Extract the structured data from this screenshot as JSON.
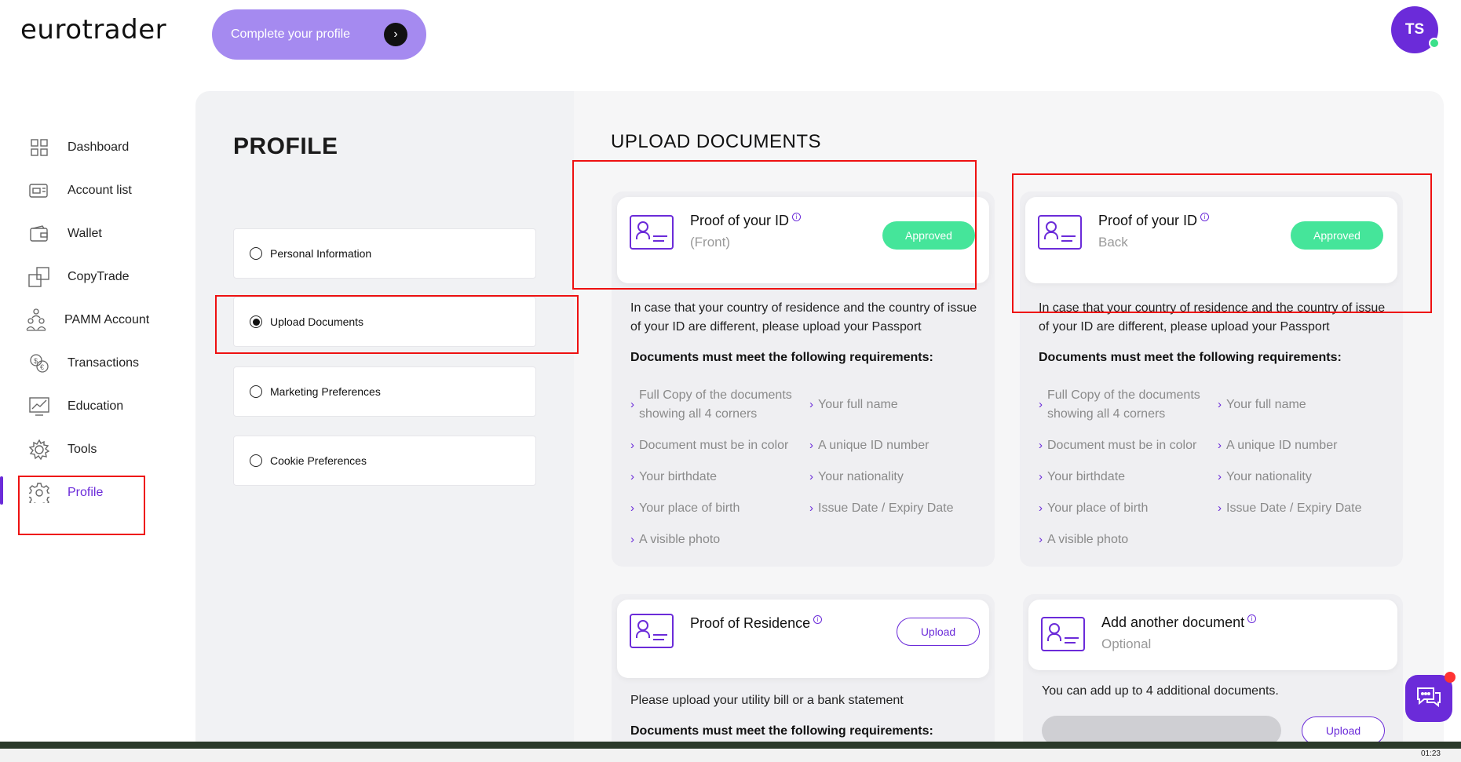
{
  "header": {
    "logo": "eurotrader",
    "cta_label": "Complete your profile",
    "avatar_initials": "TS"
  },
  "sidebar": {
    "items": [
      {
        "label": "Dashboard",
        "icon": "grid-icon"
      },
      {
        "label": "Account list",
        "icon": "account-list-icon"
      },
      {
        "label": "Wallet",
        "icon": "wallet-icon"
      },
      {
        "label": "CopyTrade",
        "icon": "copytrade-icon"
      },
      {
        "label": "PAMM Account",
        "icon": "pamm-icon"
      },
      {
        "label": "Transactions",
        "icon": "transactions-icon"
      },
      {
        "label": "Education",
        "icon": "education-icon"
      },
      {
        "label": "Tools",
        "icon": "tools-icon"
      },
      {
        "label": "Profile",
        "icon": "gear-icon"
      }
    ],
    "active": "Profile"
  },
  "profile": {
    "title": "PROFILE",
    "options": [
      {
        "label": "Personal Information",
        "selected": false
      },
      {
        "label": "Upload Documents",
        "selected": true
      },
      {
        "label": "Marketing Preferences",
        "selected": false
      },
      {
        "label": "Cookie Preferences",
        "selected": false
      }
    ]
  },
  "upload": {
    "title": "UPLOAD DOCUMENTS",
    "id_front": {
      "title": "Proof of your ID",
      "subtitle": "(Front)",
      "status": "Approved",
      "note_line1": "In case that your country of residence and the country of issue",
      "note_line2": "of your ID are different, please upload your Passport",
      "req_heading": "Documents must meet the following requirements:",
      "req_left": [
        "Full Copy of the documents showing all 4 corners",
        "Document must be in color",
        "Your birthdate",
        "Your place of birth",
        "A visible photo"
      ],
      "req_right": [
        "Your full name",
        "A unique ID number",
        "Your nationality",
        "Issue Date / Expiry Date"
      ]
    },
    "id_back": {
      "title": "Proof of your ID",
      "subtitle": "Back",
      "status": "Approved",
      "note_line1": "In case that your country of residence and the country of issue",
      "note_line2": "of your ID are different, please upload your Passport",
      "req_heading": "Documents must meet the following requirements:",
      "req_left": [
        "Full Copy of the documents showing all 4 corners",
        "Document must be in color",
        "Your birthdate",
        "Your place of birth",
        "A visible photo"
      ],
      "req_right": [
        "Your full name",
        "A unique ID number",
        "Your nationality",
        "Issue Date / Expiry Date"
      ]
    },
    "residence": {
      "title": "Proof of Residence",
      "button": "Upload",
      "note": "Please upload your utility bill or a bank statement",
      "req_heading": "Documents must meet the following requirements:"
    },
    "another": {
      "title": "Add another document",
      "subtitle": "Optional",
      "note": "You can add up to 4 additional documents.",
      "button": "Upload"
    }
  },
  "taskbar": {
    "time": "01:23"
  }
}
